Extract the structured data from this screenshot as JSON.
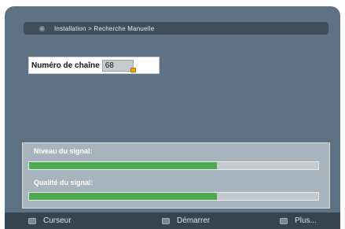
{
  "header": {
    "breadcrumb": "Installation > Recherche Manuelle",
    "icon": "menu-icon"
  },
  "channel": {
    "label": "Numéro de chaîne",
    "value": "68"
  },
  "signal": {
    "level_label": "Niveau du signal:",
    "level_fraction": 0.65,
    "quality_label": "Qualité du signal:",
    "quality_fraction": 0.65
  },
  "footer": {
    "hints": [
      {
        "label": "Curseur",
        "icon": "navigate-icon"
      },
      {
        "label": "Démarrer",
        "icon": "ok-icon"
      },
      {
        "label": "Plus...",
        "icon": "more-icon"
      }
    ]
  },
  "colors": {
    "background": "#5d7385",
    "signal_fill": "#4faa4f"
  }
}
